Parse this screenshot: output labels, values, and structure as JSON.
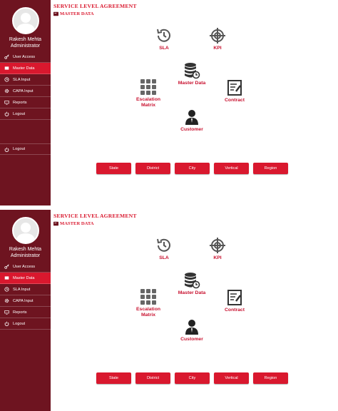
{
  "screens": [
    {
      "user": {
        "name": "Rakesh Mehta",
        "role": "Administrator"
      },
      "menu": [
        {
          "label": "User Access",
          "icon": "key-icon",
          "active": false
        },
        {
          "label": "Master Data",
          "icon": "folder-icon",
          "active": true
        },
        {
          "label": "SLA Input",
          "icon": "clock-icon",
          "active": false
        },
        {
          "label": "CAPA Input",
          "icon": "gear-icon",
          "active": false
        },
        {
          "label": "Reports",
          "icon": "monitor-icon",
          "active": false
        },
        {
          "label": "Logout",
          "icon": "power-icon",
          "active": false
        }
      ],
      "logout_bottom": "Logout",
      "page_title": "SERVICE LEVEL AGREEMENT",
      "section_title": "MASTER DATA",
      "tiles": {
        "sla": "SLA",
        "kpi": "KPI",
        "master_data": "Master Data",
        "contract": "Contract",
        "escalation": "Escalation\nMatrix",
        "customer": "Customer"
      },
      "buttons": [
        "State",
        "District",
        "City",
        "Vertical",
        "Region"
      ]
    },
    {
      "user": {
        "name": "Rakesh Mehta",
        "role": "Administrator"
      },
      "menu": [
        {
          "label": "User Access",
          "icon": "key-icon",
          "active": false
        },
        {
          "label": "Master Data",
          "icon": "folder-icon",
          "active": true
        },
        {
          "label": "SLA Input",
          "icon": "clock-icon",
          "active": false
        },
        {
          "label": "CAPA Input",
          "icon": "gear-icon",
          "active": false
        },
        {
          "label": "Reports",
          "icon": "monitor-icon",
          "active": false
        },
        {
          "label": "Logout",
          "icon": "power-icon",
          "active": false
        }
      ],
      "page_title": "SERVICE LEVEL AGREEMENT",
      "section_title": "MASTER DATA",
      "tiles": {
        "sla": "SLA",
        "kpi": "KPI",
        "master_data": "Master Data",
        "contract": "Contract",
        "escalation": "Escalation\nMatrix",
        "customer": "Customer"
      },
      "buttons": [
        "State",
        "District",
        "City",
        "Vertical",
        "Region"
      ]
    }
  ],
  "colors": {
    "sidebar": "#6e1420",
    "accent": "#d9182e",
    "icon": "#555555"
  }
}
